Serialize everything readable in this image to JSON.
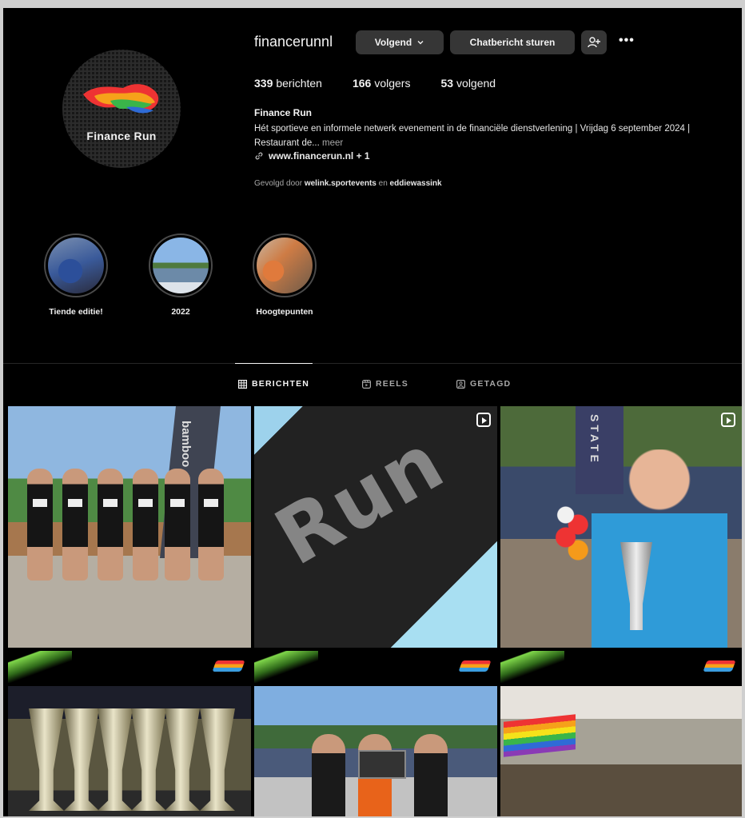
{
  "profile": {
    "username": "financerunnl",
    "avatar_text": "Finance Run",
    "follow_button": "Volgend",
    "message_button": "Chatbericht sturen",
    "more_label": "•••",
    "stats": {
      "posts_count": "339",
      "posts_label": "berichten",
      "followers_count": "166",
      "followers_label": "volgers",
      "following_count": "53",
      "following_label": "volgend"
    },
    "bio_name": "Finance Run",
    "bio_text": "Hét sportieve en informele netwerk evenement in de financiële dienstverlening | Vrijdag 6 september 2024 | Restaurant de...",
    "bio_more": "meer",
    "link": "www.financerun.nl + 1",
    "followed_by_prefix": "Gevolgd door",
    "followed_by_1": "welink.sportevents",
    "followed_by_and": "en",
    "followed_by_2": "eddiewassink"
  },
  "highlights": [
    {
      "label": "Tiende editie!"
    },
    {
      "label": "2022"
    },
    {
      "label": "Hoogtepunten"
    }
  ],
  "tabs": [
    {
      "label": "BERICHTEN",
      "active": true
    },
    {
      "label": "REELS",
      "active": false
    },
    {
      "label": "GETAGD",
      "active": false
    }
  ],
  "posts": {
    "p1_banner": "bamboo",
    "p2_text": "Run",
    "p3_banner": "STATE"
  },
  "colors": {
    "background": "#000000",
    "button": "#363636",
    "muted_text": "#a8a8a8"
  }
}
